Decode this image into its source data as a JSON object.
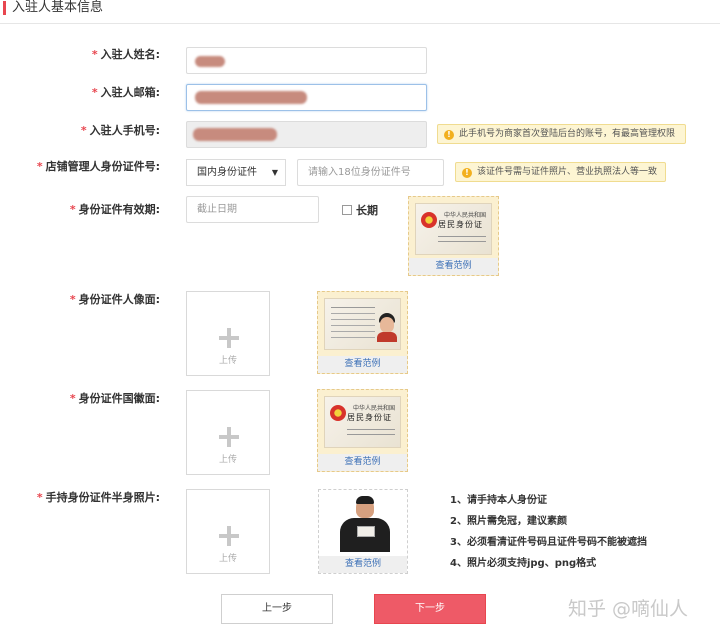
{
  "section": {
    "title": "入驻人基本信息"
  },
  "form": {
    "name": {
      "label": "入驻人姓名:"
    },
    "email": {
      "label": "入驻人邮箱:"
    },
    "phone": {
      "label": "入驻人手机号:",
      "tip": "此手机号为商家首次登陆后台的账号，有最高管理权限"
    },
    "id_number": {
      "label": "店铺管理人身份证件号:",
      "id_type": "国内身份证件",
      "placeholder": "请输入18位身份证件号",
      "tip": "该证件号需与证件照片、营业执照法人等一致"
    },
    "validity": {
      "label": "身份证件有效期:",
      "placeholder": "截止日期",
      "long_term_label": "长期"
    },
    "front": {
      "label": "身份证件人像面:"
    },
    "back": {
      "label": "身份证件国徽面:"
    },
    "handheld": {
      "label": "手持身份证件半身照片:"
    }
  },
  "upload": {
    "label": "上传"
  },
  "sample": {
    "link_label": "查看范例",
    "card_country": "中华人民共和国",
    "card_title": "居民身份证"
  },
  "instructions": [
    "1、请手持本人身份证",
    "2、照片需免冠，建议素颜",
    "3、必须看清证件号码且证件号码不能被遮挡",
    "4、照片必须支持jpg、png格式"
  ],
  "buttons": {
    "prev": "上一步",
    "next": "下一步"
  },
  "watermark": "知乎 @嘀仙人",
  "colors": {
    "accent": "#e8464f",
    "link": "#3b6fb6",
    "tip_bg": "#fdf5d3"
  },
  "icons": {
    "tip": "info-icon",
    "select": "caret-down-icon",
    "upload": "plus-icon"
  }
}
